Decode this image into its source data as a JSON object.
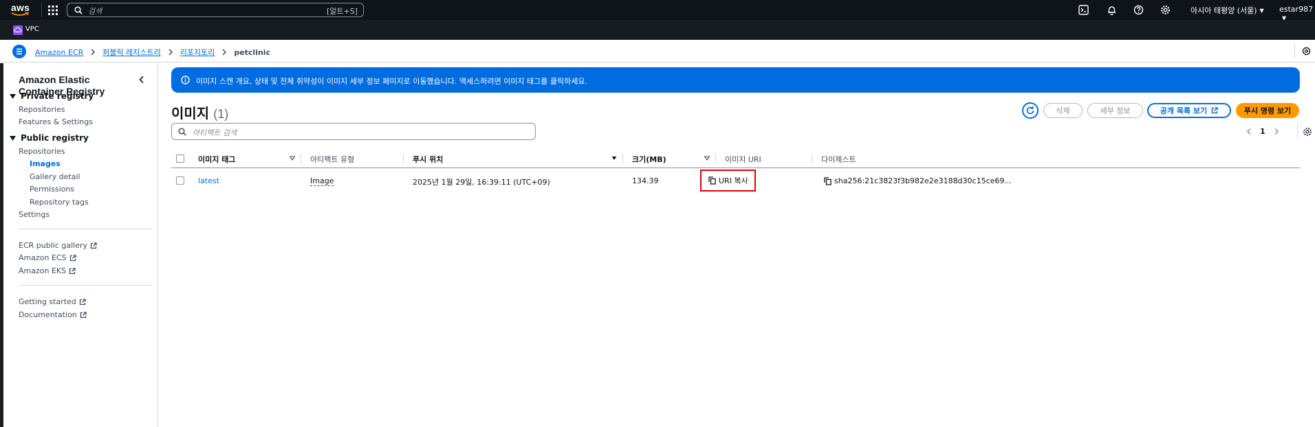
{
  "topnav": {
    "logo_text": "aws",
    "search_placeholder": "검색",
    "search_shortcut": "[알트+S]",
    "region": "아시아 태평양 (서울)",
    "account": "estar987"
  },
  "services_bar": {
    "items": [
      {
        "label": "VPC",
        "color": "#8c4fff"
      }
    ]
  },
  "breadcrumb": {
    "items": [
      "Amazon ECR",
      "퍼블릭 레지스트리",
      "리포지토리"
    ],
    "current": "petclinic"
  },
  "sidenav": {
    "title": "Amazon Elastic Container Registry",
    "sections": [
      {
        "label": "Private registry",
        "items": [
          "Repositories",
          "Features & Settings"
        ]
      },
      {
        "label": "Public registry",
        "items": [
          "Repositories"
        ]
      }
    ],
    "public_sub": [
      "Images",
      "Gallery detail",
      "Permissions",
      "Repository tags"
    ],
    "settings": "Settings",
    "external_links_1": [
      "ECR public gallery",
      "Amazon ECS",
      "Amazon EKS"
    ],
    "external_links_2": [
      "Getting started",
      "Documentation"
    ]
  },
  "flash": {
    "message": "이미지 스캔 개요, 상태 및 전체 취약성이 이미지 세부 정보 페이지로 이동했습니다. 액세스하려면 이미지 태그를 클릭하세요."
  },
  "header": {
    "title": "이미지",
    "count": "(1)",
    "buttons": {
      "delete": "삭제",
      "details": "세부 정보",
      "view_public": "공개 목록 보기",
      "view_push": "푸시 명령 보기"
    }
  },
  "filter": {
    "placeholder": "아티팩트 검색"
  },
  "pager": {
    "page": "1"
  },
  "table": {
    "columns": [
      "이미지 태그",
      "아티팩트 유형",
      "푸시 위치",
      "크기(MB)",
      "이미지 URI",
      "다이제스트"
    ],
    "rows": [
      {
        "tag": "latest",
        "artifact_type": "Image",
        "pushed_at": "2025년 1월 29일, 16:39:11 (UTC+09)",
        "size_mb": "134.39",
        "uri_action": "URI 복사",
        "digest": "sha256:21c3823f3b982e2e3188d30c15ce69..."
      }
    ]
  },
  "colors": {
    "accent": "#006ce0",
    "primary_button": "#ff9900",
    "highlight_box": "#e00000",
    "topnav_bg": "#0f141a"
  }
}
